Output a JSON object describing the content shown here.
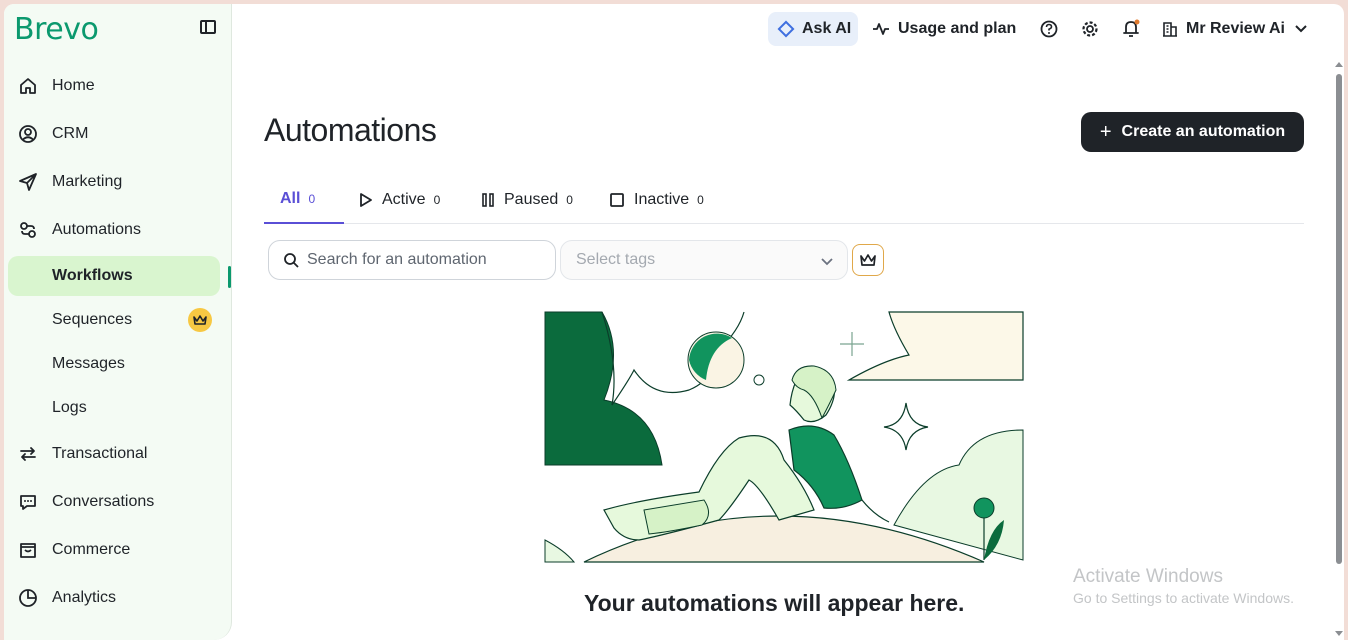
{
  "brand": "Brevo",
  "header": {
    "ask_ai": "Ask AI",
    "usage": "Usage and plan",
    "account": "Mr Review Ai"
  },
  "sidebar": {
    "items": [
      {
        "label": "Home",
        "icon": "home-icon"
      },
      {
        "label": "CRM",
        "icon": "contact-icon"
      },
      {
        "label": "Marketing",
        "icon": "send-icon"
      },
      {
        "label": "Automations",
        "icon": "automation-icon"
      }
    ],
    "subitems": [
      {
        "label": "Workflows",
        "active": true
      },
      {
        "label": "Sequences",
        "premium": true
      },
      {
        "label": "Messages"
      },
      {
        "label": "Logs"
      }
    ],
    "items_bottom": [
      {
        "label": "Transactional",
        "icon": "transfer-icon"
      },
      {
        "label": "Conversations",
        "icon": "chat-icon"
      },
      {
        "label": "Commerce",
        "icon": "bag-icon"
      },
      {
        "label": "Analytics",
        "icon": "pie-chart-icon"
      }
    ]
  },
  "main": {
    "title": "Automations",
    "create_button": "Create an automation",
    "tabs": [
      {
        "label": "All",
        "count": "0"
      },
      {
        "label": "Active",
        "count": "0"
      },
      {
        "label": "Paused",
        "count": "0"
      },
      {
        "label": "Inactive",
        "count": "0"
      }
    ],
    "search_placeholder": "Search for an automation",
    "tags_placeholder": "Select tags",
    "empty_message": "Your automations will appear here."
  },
  "watermark": {
    "title": "Activate Windows",
    "subtitle": "Go to Settings to activate Windows."
  },
  "colors": {
    "brand": "#0b996e",
    "active_tab": "#5a4fd6",
    "sidebar_bg": "#f4fbf4",
    "active_item_bg": "#d9f5cf",
    "premium": "#f7c843"
  }
}
